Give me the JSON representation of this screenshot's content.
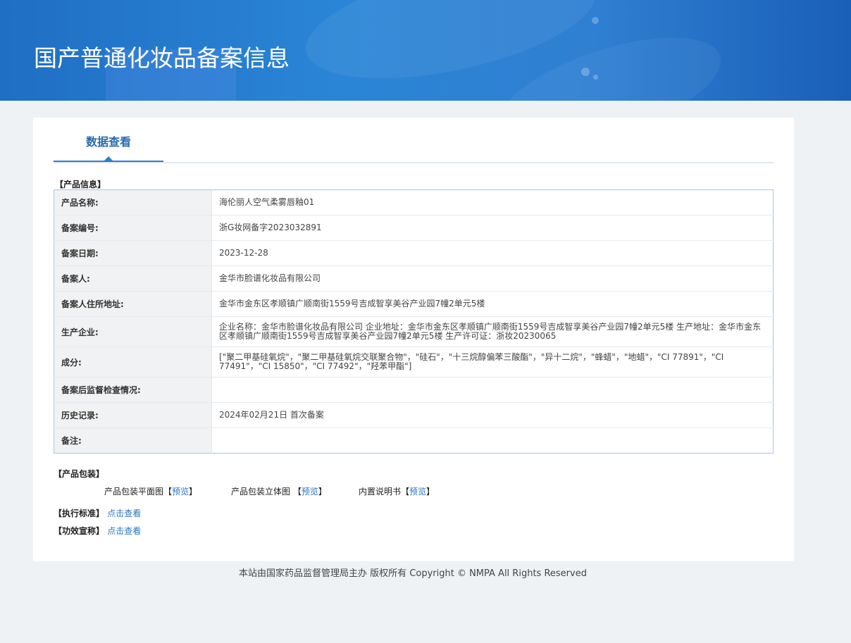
{
  "header": {
    "title": "国产普通化妆品备案信息"
  },
  "tabs": [
    {
      "label": "数据查看"
    }
  ],
  "product_info": {
    "section_label": "【产品信息】",
    "rows": [
      {
        "label": "产品名称:",
        "value": "海伦丽人空气柔雾唇釉01"
      },
      {
        "label": "备案编号:",
        "value": "浙G妆网备字2023032891"
      },
      {
        "label": "备案日期:",
        "value": "2023-12-28"
      },
      {
        "label": "备案人:",
        "value": "金华市脸谱化妆品有限公司"
      },
      {
        "label": "备案人住所地址:",
        "value": "金华市金东区孝顺镇广顺南街1559号吉成智享美谷产业园7幢2单元5楼"
      },
      {
        "label": "生产企业:",
        "value": "企业名称：金华市脸谱化妆品有限公司 企业地址：金华市金东区孝顺镇广顺南街1559号吉成智享美谷产业园7幢2单元5楼 生产地址：金华市金东区孝顺镇广顺南街1559号吉成智享美谷产业园7幢2单元5楼 生产许可证：浙妆20230065"
      },
      {
        "label": "成分:",
        "value": "[\"聚二甲基硅氧烷\"，\"聚二甲基硅氧烷交联聚合物\"，\"硅石\"，\"十三烷醇偏苯三酸酯\"，\"异十二烷\"，\"蜂蜡\"，\"地蜡\"，\"CI 77891\"，\"CI 77491\"，\"CI 15850\"，\"CI 77492\"，\"羟苯甲酯\"]"
      },
      {
        "label": "备案后监督检查情况:",
        "value": ""
      },
      {
        "label": "历史记录:",
        "value": "2024年02月21日 首次备案"
      },
      {
        "label": "备注:",
        "value": ""
      }
    ]
  },
  "packaging": {
    "section_label": "【产品包装】",
    "items": [
      {
        "label": "产品包装平面图",
        "bracket_open": "【",
        "link": "预览",
        "bracket_close": "】"
      },
      {
        "label": "产品包装立体图 ",
        "bracket_open": "【",
        "link": "预览",
        "bracket_close": "】"
      },
      {
        "label": "内置说明书",
        "bracket_open": "【",
        "link": "预览",
        "bracket_close": "】"
      }
    ]
  },
  "standard": {
    "label": "【执行标准】",
    "link": "点击查看"
  },
  "efficacy": {
    "label": "【功效宣称】",
    "link": "点击查看"
  },
  "footer": {
    "text": "本站由国家药品监督管理局主办 版权所有 Copyright © NMPA All Rights Reserved"
  },
  "colors": {
    "banner": "#2b85d6",
    "tab_accent": "#2b7fd0",
    "link": "#2a74c4",
    "table_border": "#a9c5e6"
  }
}
